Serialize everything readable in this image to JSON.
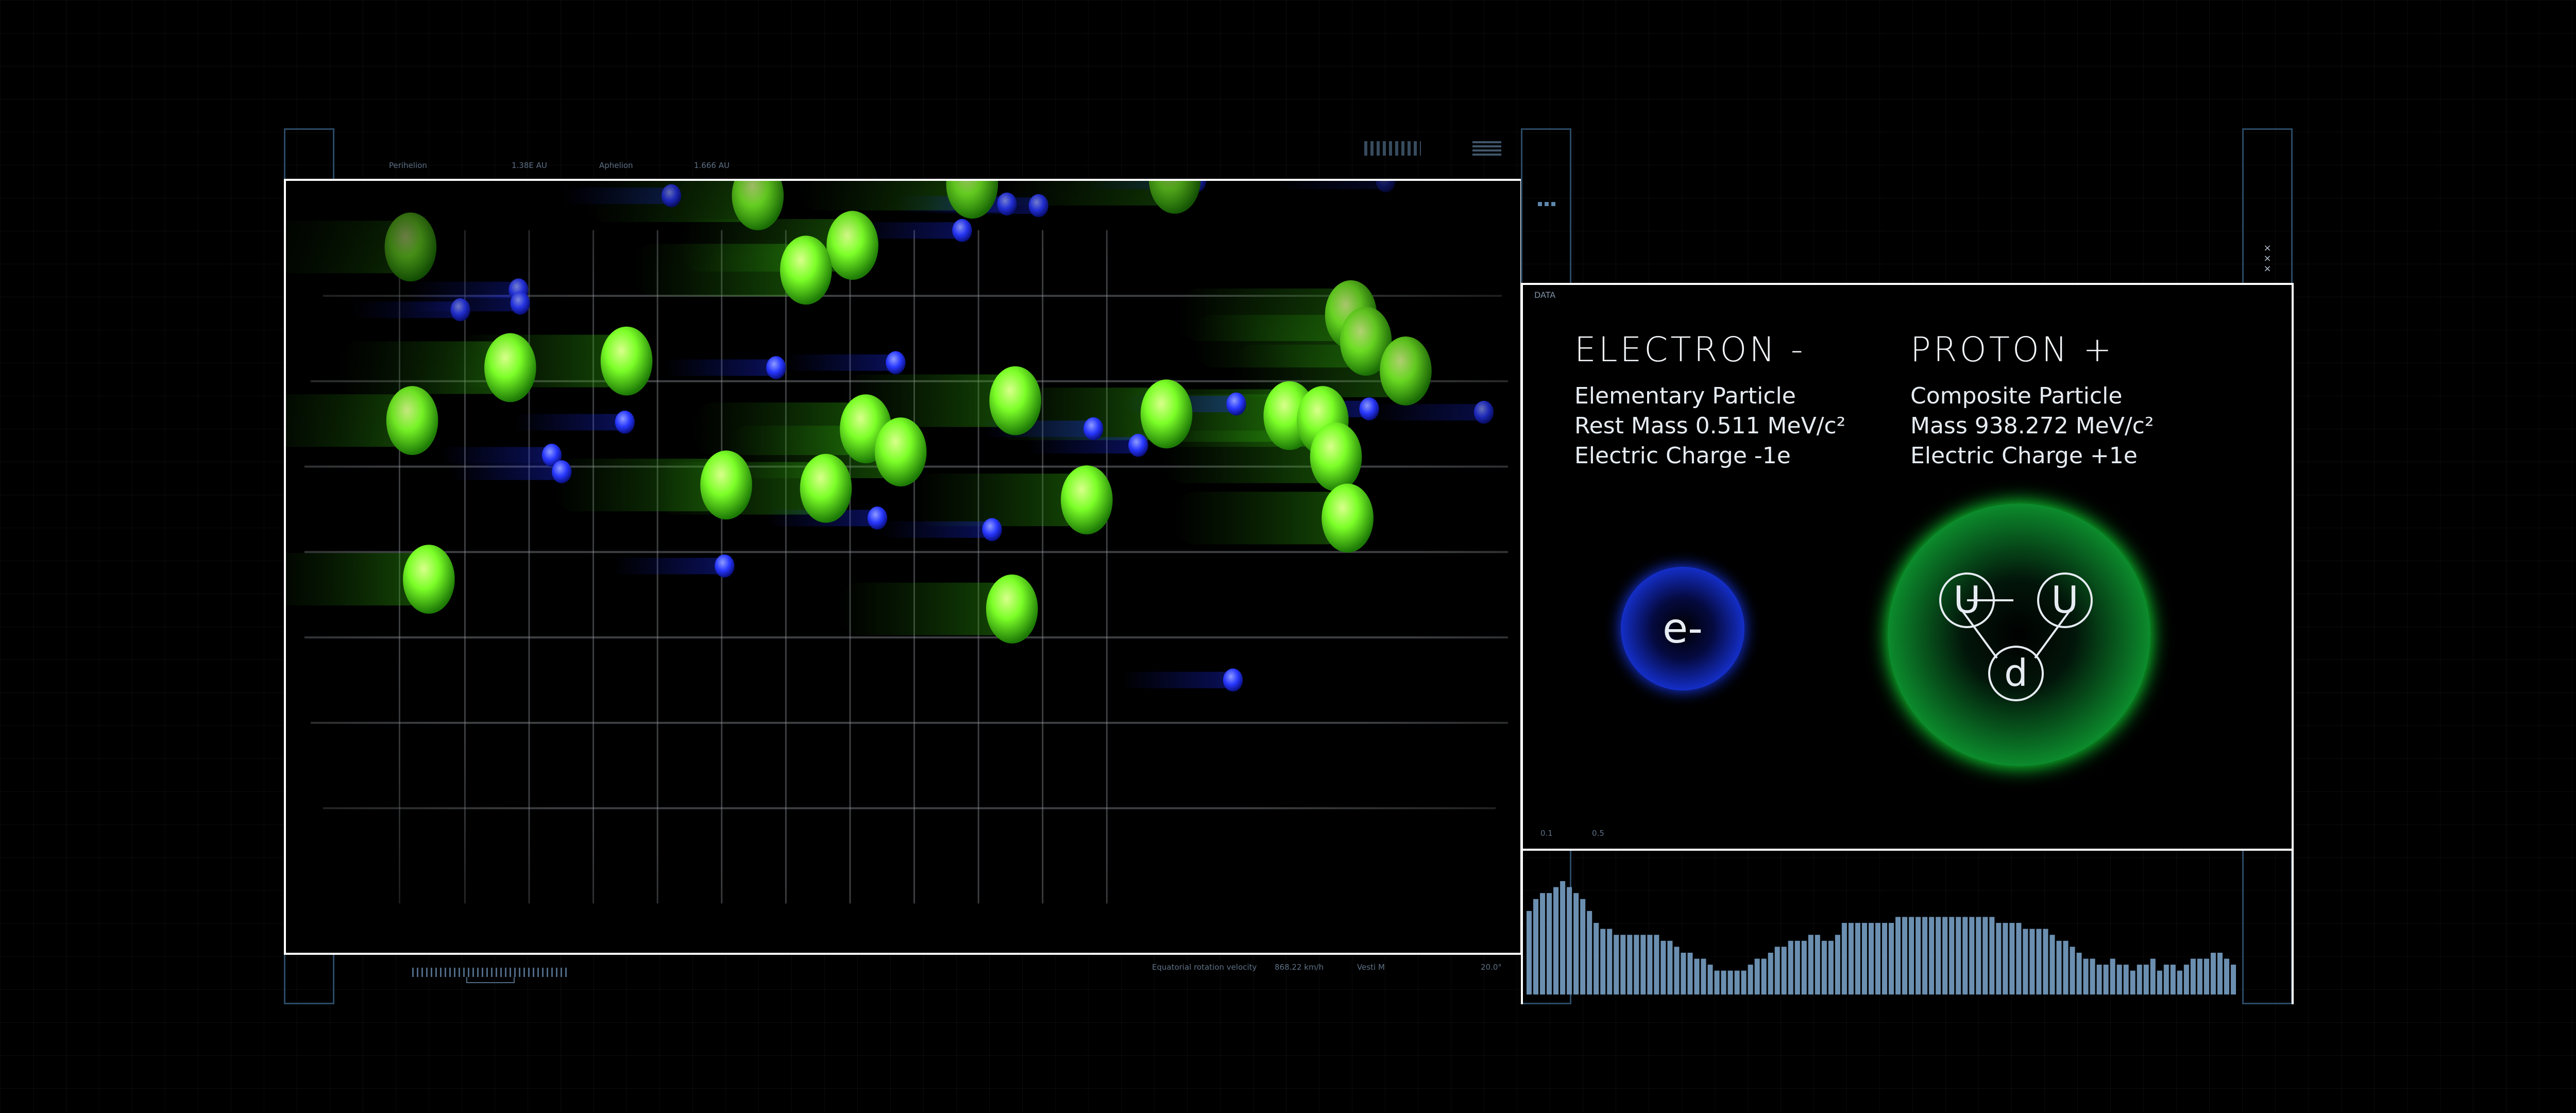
{
  "left_panel": {
    "counter": "4",
    "header_labels": [
      "Perihelion",
      "1.38E AU",
      "Aphelion",
      "1.666 AU"
    ],
    "footer_labels": [
      "Equatorial rotation velocity",
      "868.22 km/h",
      "Vesti M",
      "20.0°"
    ],
    "balls_green": [
      [
        247,
        148
      ],
      [
        456,
        117
      ],
      [
        585,
        110
      ],
      [
        707,
        107
      ],
      [
        513,
        147
      ],
      [
        485,
        162
      ],
      [
        307,
        221
      ],
      [
        377,
        217
      ],
      [
        813,
        189
      ],
      [
        822,
        205
      ],
      [
        846,
        223
      ],
      [
        248,
        253
      ],
      [
        611,
        241
      ],
      [
        521,
        258
      ],
      [
        542,
        272
      ],
      [
        702,
        249
      ],
      [
        776,
        250
      ],
      [
        796,
        253
      ],
      [
        804,
        275
      ],
      [
        437,
        292
      ],
      [
        497,
        294
      ],
      [
        654,
        301
      ],
      [
        811,
        312
      ],
      [
        258,
        349
      ],
      [
        609,
        367
      ]
    ],
    "balls_blue": [
      [
        404,
        117
      ],
      [
        606,
        122
      ],
      [
        625,
        123
      ],
      [
        579,
        138
      ],
      [
        834,
        108
      ],
      [
        720,
        108
      ],
      [
        312,
        174
      ],
      [
        313,
        182
      ],
      [
        277,
        186
      ],
      [
        467,
        221
      ],
      [
        539,
        218
      ],
      [
        376,
        254
      ],
      [
        332,
        274
      ],
      [
        338,
        284
      ],
      [
        744,
        243
      ],
      [
        824,
        246
      ],
      [
        658,
        258
      ],
      [
        685,
        268
      ],
      [
        528,
        312
      ],
      [
        597,
        319
      ],
      [
        436,
        341
      ],
      [
        742,
        410
      ],
      [
        893,
        248
      ]
    ]
  },
  "data_panel": {
    "label": "DATA",
    "bottom_labels": [
      "0.1",
      "0.5"
    ],
    "electron": {
      "title": "ELECTRON -",
      "line1": "Elementary Particle",
      "line2": "Rest Mass 0.511 MeV/c²",
      "line3": "Electric Charge -1e",
      "symbol": "e-"
    },
    "proton": {
      "title": "PROTON +",
      "line1": "Composite Particle",
      "line2": "Mass 938.272 MeV/c²",
      "line3": "Electric Charge +1e",
      "quarks": [
        "U",
        "U",
        "d"
      ]
    }
  },
  "histogram": {
    "values": [
      14,
      16,
      17,
      17,
      18,
      19,
      18,
      17,
      16,
      14,
      12,
      11,
      11,
      10,
      10,
      10,
      10,
      10,
      10,
      10,
      9,
      9,
      8,
      7,
      7,
      6,
      6,
      5,
      4,
      4,
      4,
      4,
      4,
      5,
      6,
      6,
      7,
      8,
      8,
      9,
      9,
      9,
      10,
      10,
      9,
      9,
      10,
      12,
      12,
      12,
      12,
      12,
      12,
      12,
      12,
      13,
      13,
      13,
      13,
      13,
      13,
      13,
      13,
      13,
      13,
      13,
      13,
      13,
      13,
      13,
      12,
      12,
      12,
      12,
      11,
      11,
      11,
      11,
      10,
      9,
      9,
      8,
      7,
      6,
      6,
      5,
      5,
      6,
      5,
      5,
      4,
      5,
      5,
      6,
      4,
      5,
      5,
      4,
      5,
      6,
      6,
      6,
      7,
      7,
      6,
      5
    ]
  },
  "colors": {
    "accent_orange": "#ee5a2e",
    "panel_border_blue": "#2b4a66",
    "panel_border_white": "#ffffff",
    "electron_blue": "#1a3dff",
    "proton_green": "#14ff3c",
    "histogram_bar": "#6b8fb0",
    "ball_green": "#7cff28",
    "ball_blue": "#2838ff"
  }
}
